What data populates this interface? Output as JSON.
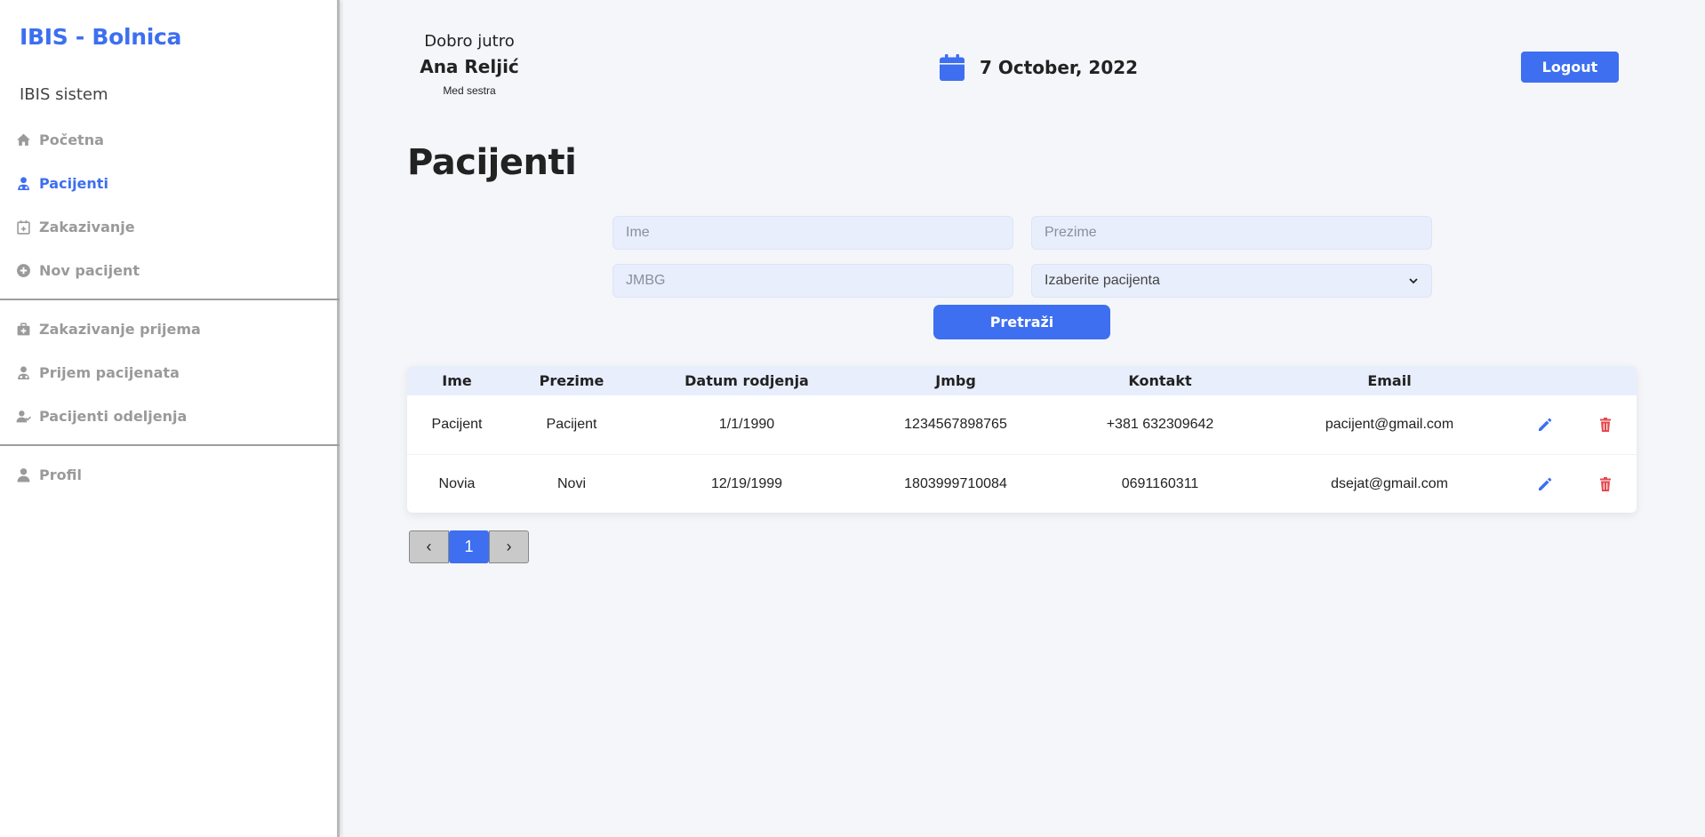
{
  "sidebar": {
    "brand": "IBIS - Bolnica",
    "subtitle": "IBIS sistem",
    "items": [
      {
        "label": "Početna",
        "icon": "home-icon"
      },
      {
        "label": "Pacijenti",
        "icon": "doctor-icon",
        "active": true
      },
      {
        "label": "Zakazivanje",
        "icon": "calendar-plus-icon"
      },
      {
        "label": "Nov pacijent",
        "icon": "plus-circle-icon"
      },
      {
        "label": "Zakazivanje prijema",
        "icon": "medkit-icon"
      },
      {
        "label": "Prijem pacijenata",
        "icon": "doctor-icon"
      },
      {
        "label": "Pacijenti odeljenja",
        "icon": "users-icon"
      },
      {
        "label": "Profil",
        "icon": "user-icon"
      }
    ]
  },
  "header": {
    "greeting": "Dobro jutro",
    "user_name": "Ana Reljić",
    "user_role": "Med sestra",
    "date": "7 October, 2022",
    "logout_label": "Logout"
  },
  "page_title": "Pacijenti",
  "search": {
    "first_name_placeholder": "Ime",
    "last_name_placeholder": "Prezime",
    "jmbg_placeholder": "JMBG",
    "patient_select_value": "Izaberite pacijenta",
    "button_label": "Pretraži"
  },
  "table": {
    "headers": [
      "Ime",
      "Prezime",
      "Datum rodjenja",
      "Jmbg",
      "Kontakt",
      "Email"
    ],
    "rows": [
      [
        "Pacijent",
        "Pacijent",
        "1/1/1990",
        "1234567898765",
        "+381 632309642",
        "pacijent@gmail.com"
      ],
      [
        "Novia",
        "Novi",
        "12/19/1999",
        "1803999710084",
        "0691160311",
        "dsejat@gmail.com"
      ]
    ]
  },
  "pagination": {
    "prev": "‹",
    "current": "1",
    "next": "›"
  },
  "colors": {
    "accent": "#3d6ff0",
    "delete": "#e5484d",
    "field_bg": "#e8eefc"
  }
}
